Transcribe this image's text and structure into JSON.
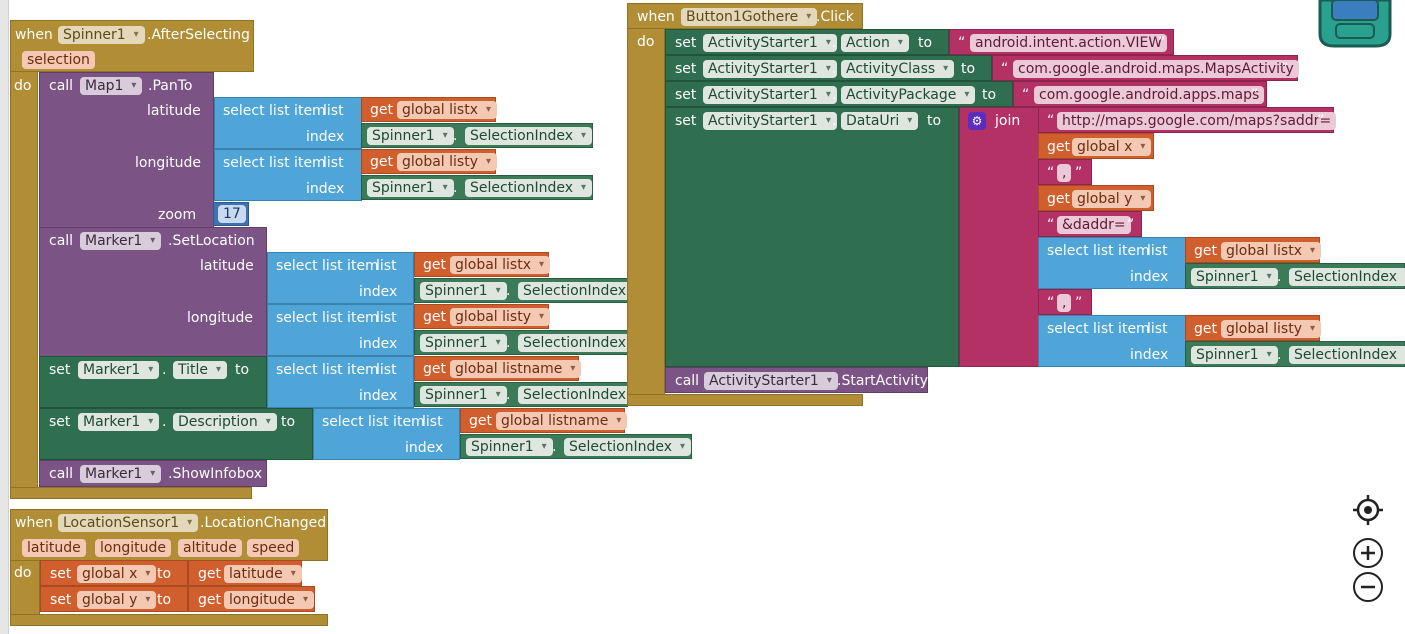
{
  "kw": {
    "when": "when",
    "do": "do",
    "call": "call",
    "set": "set",
    "to": "to",
    "get": "get",
    "dot": ".",
    "select": "select list item",
    "list": "list",
    "index": "index",
    "join": "join",
    "open_q": "“",
    "close_q": "”"
  },
  "spinner_event": {
    "component": "Spinner1",
    "event": ".AfterSelecting",
    "param": "selection",
    "panto": {
      "component": "Map1",
      "method": ".PanTo",
      "latitude_label": "latitude",
      "longitude_label": "longitude",
      "zoom_label": "zoom",
      "lat_var": "global listx",
      "lon_var": "global listy",
      "index_component": "Spinner1",
      "index_prop": "SelectionIndex",
      "zoom_value": "17"
    },
    "setlocation": {
      "component": "Marker1",
      "method": ".SetLocation",
      "latitude_label": "latitude",
      "longitude_label": "longitude",
      "lat_var": "global listx",
      "lon_var": "global listy",
      "index_component": "Spinner1",
      "index_prop": "SelectionIndex"
    },
    "set_title": {
      "component": "Marker1",
      "prop": "Title",
      "var": "global listname",
      "index_component": "Spinner1",
      "index_prop": "SelectionIndex"
    },
    "set_desc": {
      "component": "Marker1",
      "prop": "Description",
      "var": "global listname",
      "index_component": "Spinner1",
      "index_prop": "SelectionIndex"
    },
    "showinfo": {
      "component": "Marker1",
      "method": ".ShowInfobox"
    }
  },
  "location_event": {
    "component": "LocationSensor1",
    "event": ".LocationChanged",
    "params": [
      "latitude",
      "longitude",
      "altitude",
      "speed"
    ],
    "set_x": {
      "var": "global x",
      "get": "latitude"
    },
    "set_y": {
      "var": "global y",
      "get": "longitude"
    }
  },
  "button_event": {
    "component": "Button1Gothere",
    "event": ".Click",
    "action": {
      "component": "ActivityStarter1",
      "prop": "Action",
      "value": "android.intent.action.VIEW"
    },
    "class": {
      "component": "ActivityStarter1",
      "prop": "ActivityClass",
      "value": "com.google.android.maps.MapsActivity"
    },
    "package": {
      "component": "ActivityStarter1",
      "prop": "ActivityPackage",
      "value": "com.google.android.apps.maps"
    },
    "datauri": {
      "component": "ActivityStarter1",
      "prop": "DataUri",
      "text1": "http://maps.google.com/maps?saddr=",
      "var_x": "global x",
      "comma1": ",",
      "var_y": "global y",
      "daddr": "&daddr=",
      "listx": "global listx",
      "comma2": ",",
      "listy": "global listy",
      "index_component": "Spinner1",
      "index_prop": "SelectionIndex"
    },
    "start": {
      "component": "ActivityStarter1",
      "method": ".StartActivity"
    }
  },
  "tools": [
    "target-icon",
    "zoom-in-icon",
    "zoom-out-icon"
  ],
  "colors": {
    "event": "#b18e35",
    "procedure": "#7c5385",
    "lists": "#4fa4d8",
    "component": "#2f6f4f",
    "variable": "#d05f2d",
    "text": "#b33165",
    "math": "#3f71b5"
  }
}
